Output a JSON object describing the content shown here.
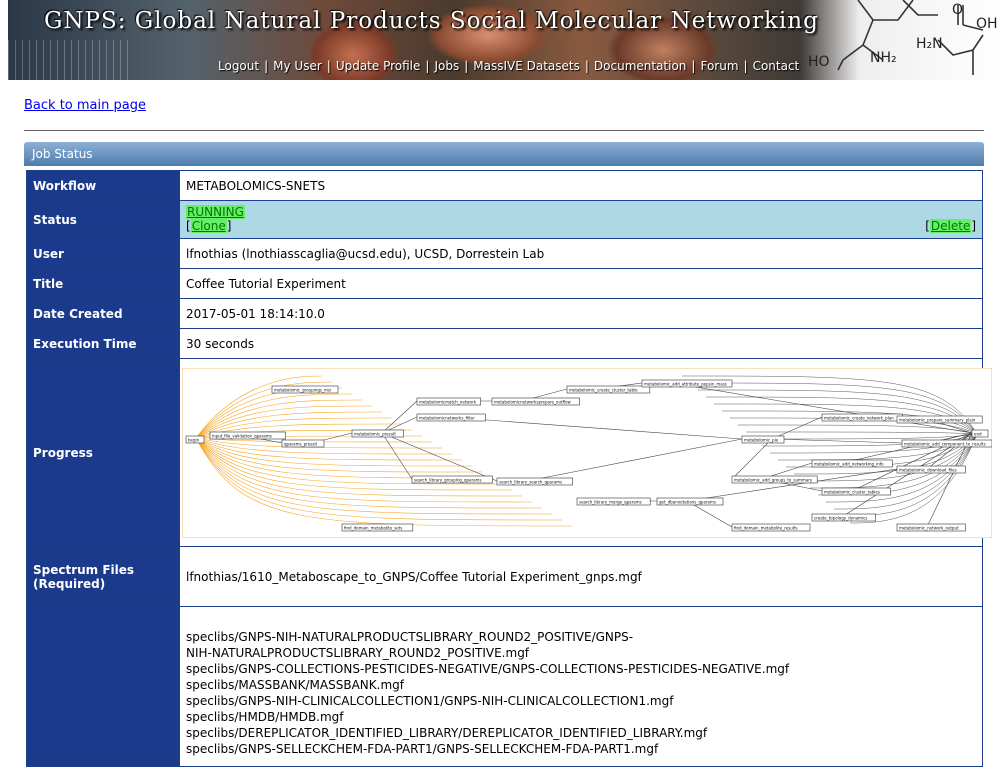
{
  "header": {
    "title": "GNPS: Global Natural Products Social Molecular Networking",
    "nav": [
      "Logout",
      "My User",
      "Update Profile",
      "Jobs",
      "MassIVE Datasets",
      "Documentation",
      "Forum",
      "Contact"
    ],
    "molecule_labels": {
      "ho": "HO",
      "nh2": "NH₂",
      "h2n": "H₂N",
      "oh": "OH",
      "o": "O"
    }
  },
  "back_link": "Back to main page",
  "panel_title": "Job Status",
  "job": {
    "workflow_label": "Workflow",
    "workflow": "METABOLOMICS-SNETS",
    "status_label": "Status",
    "status": "RUNNING",
    "clone": "Clone",
    "delete": "Delete",
    "user_label": "User",
    "user": "lfnothias (lnothiasscaglia@ucsd.edu), UCSD, Dorrestein Lab",
    "title_label": "Title",
    "title": "Coffee Tutorial Experiment",
    "date_label": "Date Created",
    "date": "2017-05-01 18:14:10.0",
    "exec_label": "Execution Time",
    "exec": "30 seconds",
    "progress_label": "Progress",
    "spectrum_label_1": "Spectrum Files",
    "spectrum_label_2": "(Required)",
    "spectrum_file": "lfnothias/1610_Metaboscape_to_GNPS/Coffee Tutorial Experiment_gnps.mgf",
    "libraries": [
      "speclibs/GNPS-NIH-NATURALPRODUCTSLIBRARY_ROUND2_POSITIVE/GNPS-",
      "NIH-NATURALPRODUCTSLIBRARY_ROUND2_POSITIVE.mgf",
      "speclibs/GNPS-COLLECTIONS-PESTICIDES-NEGATIVE/GNPS-COLLECTIONS-PESTICIDES-NEGATIVE.mgf",
      "speclibs/MASSBANK/MASSBANK.mgf",
      "speclibs/GNPS-NIH-CLINICALCOLLECTION1/GNPS-NIH-CLINICALCOLLECTION1.mgf",
      "speclibs/HMDB/HMDB.mgf",
      "speclibs/DEREPLICATOR_IDENTIFIED_LIBRARY/DEREPLICATOR_IDENTIFIED_LIBRARY.mgf",
      "speclibs/GNPS-SELLECKCHEM-FDA-PART1/GNPS-SELLECKCHEM-FDA-PART1.mgf"
    ]
  },
  "colors": {
    "header_blue": "#1b3a8c",
    "status_bg": "#add8e6",
    "running_green": "#66ee66",
    "link": "#0000ee",
    "edge_orange": "#f5a623"
  },
  "workflow_nodes": [
    "begin",
    "input_file_validation_qparams",
    "qparams_pressit",
    "metabolomic_presult",
    "metabolomic_groupings_msi",
    "metabolomicmatch_network",
    "metabolomicnetworks_filter",
    "metabolomicnetworksprepare_outflow",
    "metabolomic_create_cluster_table",
    "metabolomic_add_attribute_pepsin_mass",
    "search_library_grouping_qparams",
    "search_library_search_qparams",
    "search_library_merge_qparams",
    "get_dbannotations_qparams",
    "find_domain_metabolite_sets",
    "metabolomic_pie",
    "metabolomic_add_groups_to_summary",
    "metabolomic_add_networking_info",
    "metabolomic_cluster_tables",
    "metabolomic_create_network_plan",
    "metabolomic_prepare_summary_plain",
    "metabolomic_add_component_to_results",
    "metabolomic_download_files",
    "create_topology_dynamics",
    "metabolomic_network_output",
    "find_domain_metabolite_results",
    "end"
  ]
}
